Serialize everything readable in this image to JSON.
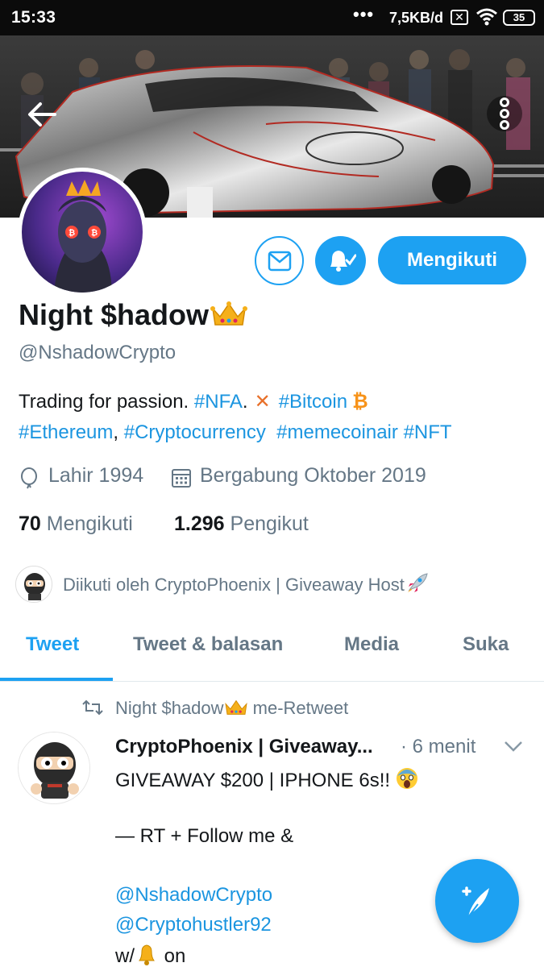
{
  "status_bar": {
    "time": "15:33",
    "dots": "•••",
    "speed": "7,5KB/d",
    "x_icon": "✕",
    "battery": "35"
  },
  "profile": {
    "name": "Night $hadow",
    "handle": "@NshadowCrypto",
    "follow_button": "Mengikuti",
    "bio_text_1": "Trading for passion. ",
    "bio_tag_nfa": "#NFA",
    "bio_dot": ".",
    "bio_x": "✕",
    "bio_tag_bitcoin": "#Bitcoin",
    "bio_btc": "₿",
    "bio_tag_ethereum": "#Ethereum",
    "bio_comma": ", ",
    "bio_tag_crypto": "#Cryptocurrency",
    "bio_tag_meme": "#memecoinair",
    "bio_tag_nft": "#NFT",
    "birth": "Lahir 1994",
    "joined": "Bergabung Oktober 2019",
    "following_count": "70",
    "following_label": "Mengikuti",
    "followers_count": "1.296",
    "followers_label": "Pengikut",
    "followed_by": "Diikuti oleh CryptoPhoenix | Giveaway Host"
  },
  "tabs": [
    "Tweet",
    "Tweet & balasan",
    "Media",
    "Suka"
  ],
  "tweet": {
    "retweet_by": "Night $hadow",
    "retweet_suffix": " me-Retweet",
    "author": "CryptoPhoenix | Giveaway...",
    "time": "· 6 menit",
    "line1": "GIVEAWAY $200 | IPHONE 6s!!",
    "line2": "— RT + Follow me &",
    "mention1": "@NshadowCrypto",
    "mention2": "@Cryptohustler92",
    "line_last_prefix": "w/",
    "line_last_suffix": " on"
  },
  "colors": {
    "accent": "#1da1f2",
    "link": "#1b95e0",
    "muted": "#657786"
  },
  "icons": [
    "back-arrow-icon",
    "more-vertical-icon",
    "mail-icon",
    "bell-check-icon",
    "crown-icon",
    "balloon-icon",
    "calendar-icon",
    "retweet-icon",
    "chevron-down-icon",
    "compose-tweet-icon",
    "rocket-icon",
    "screaming-face-icon",
    "bell-emoji-icon"
  ]
}
